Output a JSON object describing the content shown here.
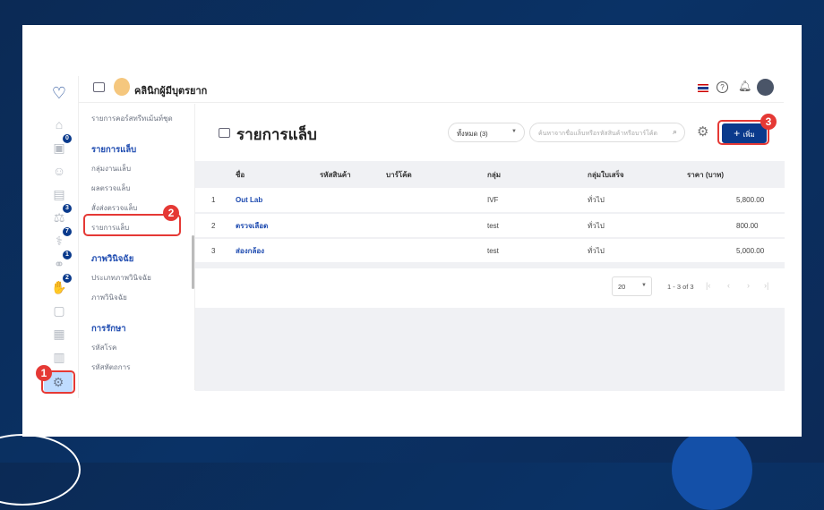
{
  "header": {
    "clinic_name": "คลินิกผู้มีบุตรยาก"
  },
  "rail": {
    "badges": {
      "calendar": "0",
      "equipment": "3",
      "stethoscope": "7",
      "pills": "1",
      "hand": "2"
    }
  },
  "sidebar": {
    "top_item": "รายการคอร์สทรีทเม้นท์ชุด",
    "sections": [
      {
        "title": "รายการแล็บ",
        "items": [
          "กลุ่มงานแล็บ",
          "ผลตรวจแล็บ",
          "สั่งส่งตรวจแล็บ",
          "รายการแล็บ"
        ]
      },
      {
        "title": "ภาพวินิจฉัย",
        "items": [
          "ประเภทภาพวินิจฉัย",
          "ภาพวินิจฉัย"
        ]
      },
      {
        "title": "การรักษา",
        "items": [
          "รหัสโรค",
          "รหัสหัตถการ"
        ]
      }
    ]
  },
  "page": {
    "title": "รายการแล็บ",
    "filter": "ทั้งหมด (3)",
    "search_placeholder": "ค้นหาจากชื่อแล็บหรือรหัสสินค้าหรือบาร์โค้ด",
    "add_label": "เพิ่ม"
  },
  "table": {
    "headers": [
      "ชื่อ",
      "รหัสสินค้า",
      "บาร์โค้ด",
      "กลุ่ม",
      "กลุ่มใบเสร็จ",
      "ราคา (บาท)"
    ],
    "rows": [
      {
        "no": "1",
        "name": "Out Lab",
        "code": "",
        "barcode": "",
        "group": "IVF",
        "receipt_group": "ทั่วไป",
        "price": "5,800.00"
      },
      {
        "no": "2",
        "name": "ตรวจเลือด",
        "code": "",
        "barcode": "",
        "group": "test",
        "receipt_group": "ทั่วไป",
        "price": "800.00"
      },
      {
        "no": "3",
        "name": "ส่องกล้อง",
        "code": "",
        "barcode": "",
        "group": "test",
        "receipt_group": "ทั่วไป",
        "price": "5,000.00"
      }
    ]
  },
  "pagination": {
    "page_size": "20",
    "range": "1 - 3 of 3"
  },
  "annotations": [
    "1",
    "2",
    "3"
  ],
  "colors": {
    "primary": "#0a3a8c",
    "accent": "#1e4bb0",
    "highlight": "#e53935"
  }
}
